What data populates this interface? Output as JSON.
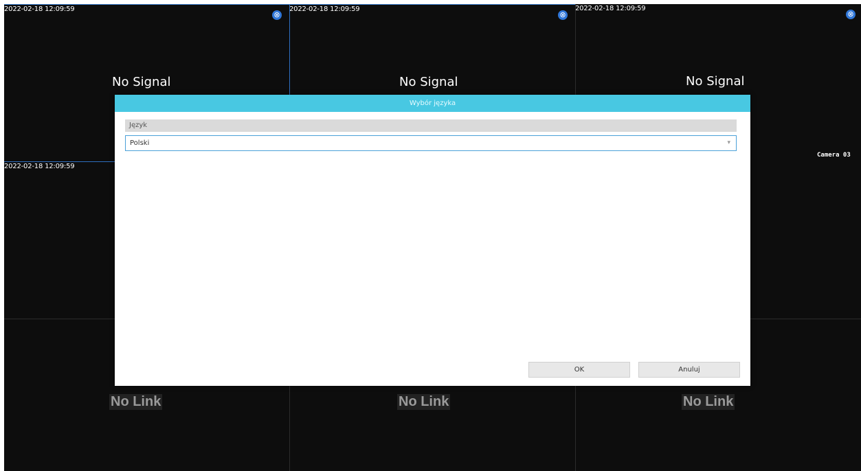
{
  "tiles": [
    {
      "timestamp": "2022-02-18 12:09:59",
      "message": "No Signal",
      "icon": "camera-link-icon"
    },
    {
      "timestamp": "2022-02-18 12:09:59",
      "message": "No Signal",
      "icon": "camera-link-icon"
    },
    {
      "timestamp": "2022-02-18 12:09:59",
      "message": "No Signal",
      "icon": "camera-link-icon",
      "camera_name": "Camera 03"
    },
    {
      "timestamp": "2022-02-18 12:09:59",
      "message": ""
    },
    {
      "message": ""
    },
    {
      "message": ""
    },
    {
      "message": "No Link"
    },
    {
      "message": "No Link"
    },
    {
      "message": "No Link"
    }
  ],
  "dialog": {
    "title": "Wybór języka",
    "language_label": "Język",
    "language_value": "Polski",
    "ok_label": "OK",
    "cancel_label": "Anuluj"
  },
  "colors": {
    "dialog_header": "#48c8e2",
    "selection_border": "#2f72c4",
    "icon_blue": "#2f76d8"
  }
}
